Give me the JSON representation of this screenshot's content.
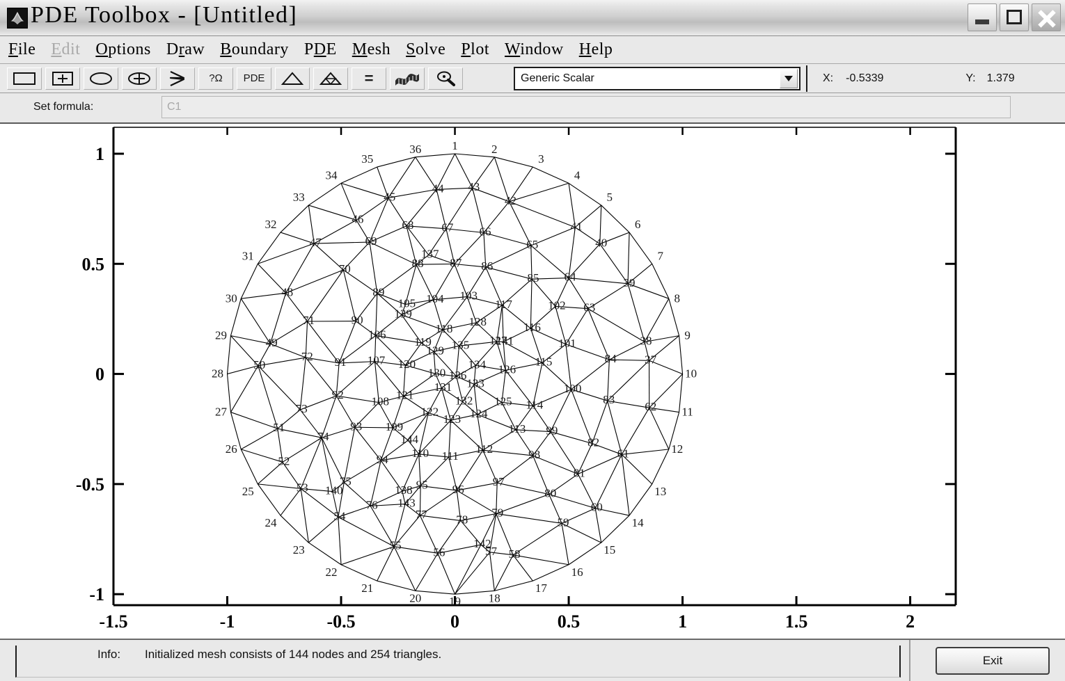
{
  "window": {
    "title": "PDE Toolbox - [Untitled]",
    "icon": "matlab-membrane-icon",
    "controls": {
      "minimize": "minimize-icon",
      "maximize": "maximize-icon",
      "close": "close-icon"
    }
  },
  "menu": [
    {
      "label": "File",
      "mnemonic": "F",
      "disabled": false
    },
    {
      "label": "Edit",
      "mnemonic": "E",
      "disabled": true
    },
    {
      "label": "Options",
      "mnemonic": "O",
      "disabled": false
    },
    {
      "label": "Draw",
      "mnemonic": "r",
      "disabled": false
    },
    {
      "label": "Boundary",
      "mnemonic": "B",
      "disabled": false
    },
    {
      "label": "PDE",
      "mnemonic": "D",
      "disabled": false
    },
    {
      "label": "Mesh",
      "mnemonic": "M",
      "disabled": false
    },
    {
      "label": "Solve",
      "mnemonic": "S",
      "disabled": false
    },
    {
      "label": "Plot",
      "mnemonic": "P",
      "disabled": false
    },
    {
      "label": "Window",
      "mnemonic": "W",
      "disabled": false
    },
    {
      "label": "Help",
      "mnemonic": "H",
      "disabled": false
    }
  ],
  "toolbar": {
    "buttons": [
      {
        "name": "draw-rectangle-button",
        "icon": "rectangle-icon",
        "label": ""
      },
      {
        "name": "draw-rectangle-center-button",
        "icon": "rectangle-center-icon",
        "label": ""
      },
      {
        "name": "draw-ellipse-button",
        "icon": "ellipse-icon",
        "label": ""
      },
      {
        "name": "draw-ellipse-center-button",
        "icon": "ellipse-center-icon",
        "label": ""
      },
      {
        "name": "draw-polygon-button",
        "icon": "polygon-icon",
        "label": ""
      },
      {
        "name": "boundary-mode-button",
        "icon": "omega-question-icon",
        "label": "?Ω"
      },
      {
        "name": "pde-specification-button",
        "icon": "pde-text-icon",
        "label": "PDE"
      },
      {
        "name": "initialize-mesh-button",
        "icon": "triangle-icon",
        "label": ""
      },
      {
        "name": "refine-mesh-button",
        "icon": "triangle-refined-icon",
        "label": ""
      },
      {
        "name": "solve-pde-button",
        "icon": "equals-icon",
        "label": "="
      },
      {
        "name": "plot-solution-button",
        "icon": "surface-plot-icon",
        "label": ""
      },
      {
        "name": "zoom-button",
        "icon": "magnifier-icon",
        "label": ""
      }
    ],
    "application_mode": {
      "selected": "Generic Scalar",
      "arrow_icon": "chevron-down-icon"
    },
    "coordinates": {
      "x_label": "X:",
      "x_value": "-0.5339",
      "y_label": "Y:",
      "y_value": "1.379"
    }
  },
  "formula": {
    "label": "Set formula:",
    "value": "C1"
  },
  "status": {
    "info_label": "Info:",
    "info_text": "Initialized mesh consists of 144 nodes and 254 triangles.",
    "exit_label": "Exit"
  },
  "chart_data": {
    "type": "mesh",
    "title": "",
    "xlabel": "",
    "ylabel": "",
    "xlim": [
      -1.5,
      2.2
    ],
    "ylim": [
      -1.05,
      1.12
    ],
    "xticks": [
      -1.5,
      -1,
      -0.5,
      0,
      0.5,
      1,
      1.5,
      2
    ],
    "xticklabels": [
      "-1.5",
      "-1",
      "-0.5",
      "0",
      "0.5",
      "1",
      "1.5",
      "2"
    ],
    "yticks": [
      -1,
      -0.5,
      0,
      0.5,
      1
    ],
    "yticklabels": [
      "-1",
      "-0.5",
      "0",
      "0.5",
      "1"
    ],
    "grid": false,
    "legend": false,
    "geometry": "unit-circle",
    "circle_center": [
      0,
      0
    ],
    "circle_radius": 1.0,
    "node_count": 144,
    "triangle_count": 254,
    "boundary_nodes": 36,
    "node_labels_shown": true,
    "mesh_line_color": "#000000",
    "mesh_line_width": 1.1,
    "axis_color": "#000000"
  }
}
